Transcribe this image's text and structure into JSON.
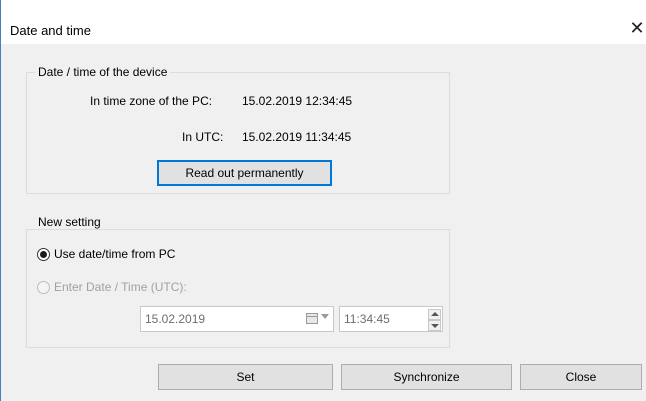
{
  "window": {
    "title": "Date and time",
    "close_glyph": "✕",
    "accent_color": "#0078d7"
  },
  "device_group": {
    "legend": "Date / time of the device",
    "pc_zone_label": "In time zone of the PC:",
    "pc_zone_value": "15.02.2019 12:34:45",
    "utc_label": "In UTC:",
    "utc_value": "15.02.2019 11:34:45",
    "read_button": "Read out permanently"
  },
  "new_setting_group": {
    "legend": "New setting",
    "option_pc_label": "Use date/time from PC",
    "option_pc_selected": true,
    "option_manual_label": "Enter Date / Time (UTC):",
    "option_manual_enabled": false,
    "date_value": "15.02.2019",
    "time_value": "11:34:45"
  },
  "buttons": {
    "set": "Set",
    "synchronize": "Synchronize",
    "close": "Close"
  }
}
